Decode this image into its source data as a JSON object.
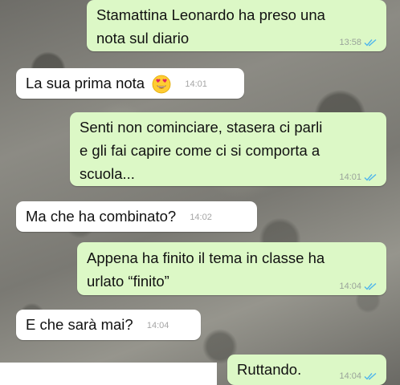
{
  "chat": {
    "messages": [
      {
        "direction": "outgoing",
        "text": "Stamattina Leonardo ha preso una\nnota sul diario",
        "time": "13:58",
        "status": "read-double-check-icon"
      },
      {
        "direction": "incoming",
        "text": "La sua prima nota",
        "emoji": "heart-eyes-emoji",
        "time": "14:01"
      },
      {
        "direction": "outgoing",
        "text": "Senti non cominciare, stasera ci parli\ne gli fai capire come ci si comporta a\nscuola...",
        "time": "14:01",
        "status": "read-double-check-icon"
      },
      {
        "direction": "incoming",
        "text": "Ma che ha combinato?",
        "time": "14:02"
      },
      {
        "direction": "outgoing",
        "text": "Appena ha finito il tema in classe ha\nurlato “finito”",
        "time": "14:04",
        "status": "read-double-check-icon"
      },
      {
        "direction": "incoming",
        "text": "E che sarà mai?",
        "time": "14:04"
      },
      {
        "direction": "outgoing",
        "text": "Ruttando.",
        "time": "14:04",
        "status": "read-double-check-icon"
      }
    ]
  },
  "colors": {
    "outgoing_bubble": "#dcf8c6",
    "incoming_bubble": "#ffffff",
    "read_check": "#4fb6ec"
  }
}
